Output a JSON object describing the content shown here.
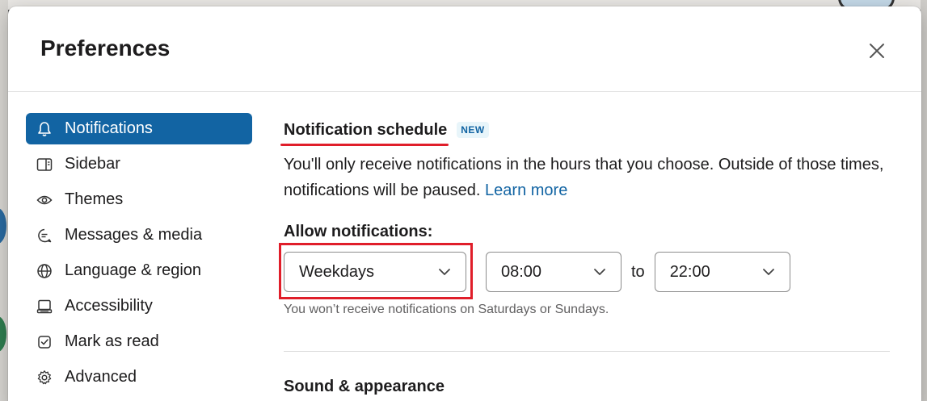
{
  "modal": {
    "title": "Preferences"
  },
  "sidebar": {
    "items": [
      {
        "label": "Notifications",
        "icon": "bell-icon",
        "active": true
      },
      {
        "label": "Sidebar",
        "icon": "sidebar-icon",
        "active": false
      },
      {
        "label": "Themes",
        "icon": "eye-icon",
        "active": false
      },
      {
        "label": "Messages & media",
        "icon": "message-icon",
        "active": false
      },
      {
        "label": "Language & region",
        "icon": "globe-icon",
        "active": false
      },
      {
        "label": "Accessibility",
        "icon": "keyboard-icon",
        "active": false
      },
      {
        "label": "Mark as read",
        "icon": "check-square-icon",
        "active": false
      },
      {
        "label": "Advanced",
        "icon": "gear-icon",
        "active": false
      }
    ]
  },
  "content": {
    "section_title": "Notification schedule",
    "badge": "NEW",
    "description": "You'll only receive notifications in the hours that you choose. Outside of those times, notifications will be paused.",
    "learn_more": "Learn more",
    "allow_label": "Allow notifications:",
    "day_select": "Weekdays",
    "start_time": "08:00",
    "to_label": "to",
    "end_time": "22:00",
    "hint": "You won’t receive notifications on Saturdays or Sundays.",
    "section2_title": "Sound & appearance"
  },
  "colors": {
    "accent": "#1264a3",
    "highlight": "#e01e2a"
  }
}
